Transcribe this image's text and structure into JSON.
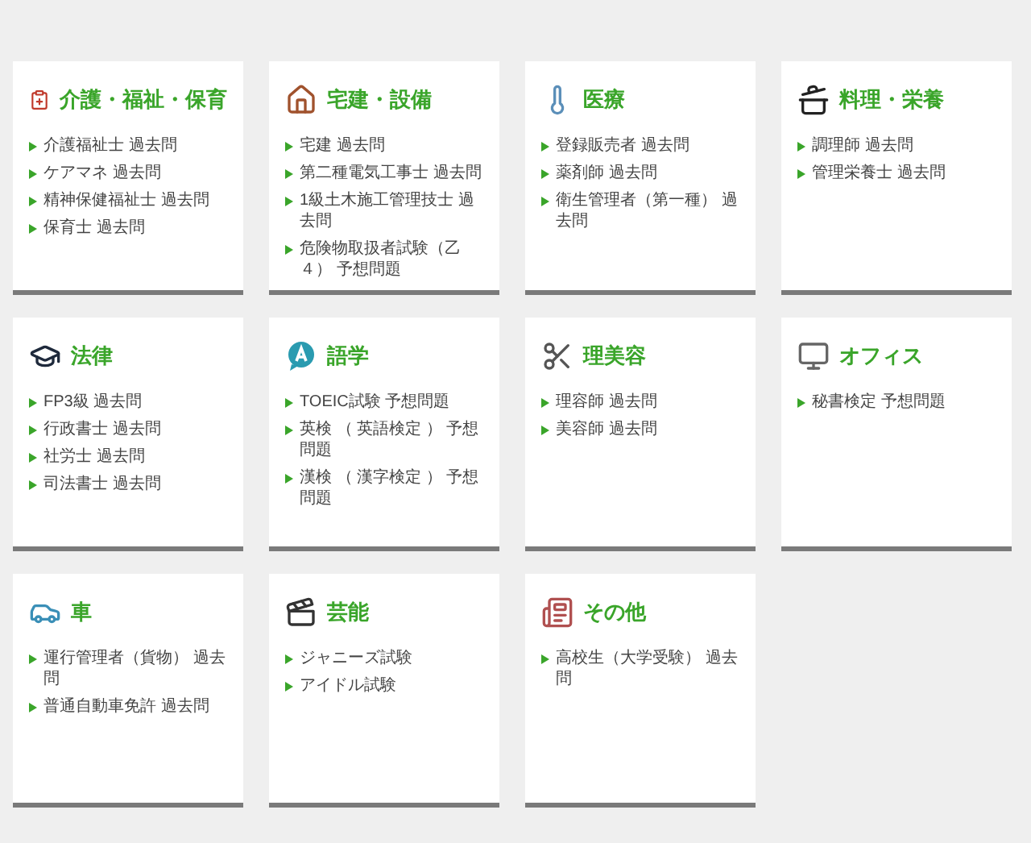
{
  "categories": [
    {
      "title": "介護・福祉・保育",
      "items": [
        "介護福祉士 過去問",
        "ケアマネ 過去問",
        "精神保健福祉士 過去問",
        "保育士 過去問"
      ]
    },
    {
      "title": "宅建・設備",
      "items": [
        "宅建 過去問",
        "第二種電気工事士 過去問",
        "1級土木施工管理技士 過去問",
        "危険物取扱者試験（乙４） 予想問題"
      ]
    },
    {
      "title": "医療",
      "items": [
        "登録販売者 過去問",
        "薬剤師 過去問",
        "衛生管理者（第一種） 過去問"
      ]
    },
    {
      "title": "料理・栄養",
      "items": [
        "調理師 過去問",
        "管理栄養士 過去問"
      ]
    },
    {
      "title": "法律",
      "items": [
        "FP3級 過去問",
        "行政書士 過去問",
        "社労士 過去問",
        "司法書士 過去問"
      ]
    },
    {
      "title": "語学",
      "items": [
        "TOEIC試験 予想問題",
        "英検 （ 英語検定 ） 予想問題",
        "漢検 （ 漢字検定 ） 予想問題"
      ]
    },
    {
      "title": "理美容",
      "items": [
        "理容師 過去問",
        "美容師 過去問"
      ]
    },
    {
      "title": "オフィス",
      "items": [
        "秘書検定 予想問題"
      ]
    },
    {
      "title": "車",
      "items": [
        "運行管理者（貨物） 過去問",
        "普通自動車免許 過去問"
      ]
    },
    {
      "title": "芸能",
      "items": [
        "ジャニーズ試験",
        "アイドル試験"
      ]
    },
    {
      "title": "その他",
      "items": [
        "高校生（大学受験） 過去問"
      ]
    }
  ]
}
